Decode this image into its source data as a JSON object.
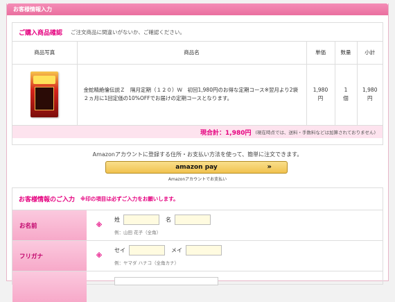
{
  "header": {
    "title": "お客様情報入力"
  },
  "confirm": {
    "title": "ご購入商品確認",
    "note": "ご注文商品に間違いがないか、ご確認ください。",
    "columns": [
      "商品写真",
      "商品名",
      "単価",
      "数量",
      "小計"
    ],
    "item": {
      "name": "金蛇精絶倫伝説Ｚ　隔月定期（１２０）Ｗ　初回1,980円のお得な定期コース※翌月より2袋２ヵ月に1回定価の10%OFFでお届けの定期コースとなります。",
      "unit_price": "1,980\n円",
      "quantity": "1\n個",
      "subtotal": "1,980\n円"
    },
    "total_label": "現合計：1,980円",
    "total_note": "(現在時点では、送料・手数料などは加算されておりません)"
  },
  "amazon": {
    "message": "Amazonアカウントに登録する住所・お支払い方法を使って、簡単に注文できます。",
    "button_logo": "amazon pay",
    "button_chevron": "»",
    "sub": "Amazonアカウントでお支払い"
  },
  "customer": {
    "title": "お客様情報のご入力",
    "required_note": "※印の項目は必ずご入力をお願いします。",
    "required_mark": "※",
    "name_row": {
      "label": "お名前",
      "sei": "姓",
      "mei": "名",
      "hint": "例：山田 花子（全角）"
    },
    "kana_row": {
      "label": "フリガナ",
      "sei": "セイ",
      "mei": "メイ",
      "hint": "例：ヤマダ ハナコ（全角カナ）"
    }
  }
}
